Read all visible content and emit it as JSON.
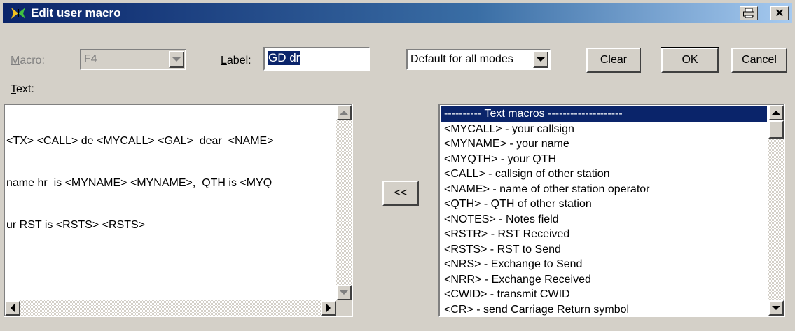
{
  "window": {
    "title": "Edit user macro"
  },
  "macro": {
    "label": "Macro:",
    "value": "F4"
  },
  "label_field": {
    "label": "Label:",
    "value": "GD dr"
  },
  "text_label": "Text:",
  "mode": {
    "value": "Default for all modes"
  },
  "buttons": {
    "clear": "Clear",
    "ok": "OK",
    "cancel": "Cancel",
    "insert": "<<"
  },
  "text_content": [
    "<TX> <CALL> de <MYCALL> <GAL>  dear  <NAME>",
    "name hr  is <MYNAME> <MYNAME>,  QTH is <MYQ",
    "ur RST is <RSTS> <RSTS>"
  ],
  "list": {
    "items": [
      "---------- Text macros --------------------",
      "<MYCALL> - your callsign",
      "<MYNAME> - your name",
      "<MYQTH> - your QTH",
      "<CALL> - callsign of other station",
      "<NAME> - name of other station operator",
      "<QTH> - QTH of other station",
      "<NOTES> - Notes field",
      "<RSTR> - RST Received",
      "<RSTS> - RST to Send",
      "<NRS> - Exchange to Send",
      "<NRR> - Exchange Received",
      "<CWID> - transmit CWID",
      "<CR> - send Carriage Return symbol"
    ],
    "selected_index": 0
  },
  "icons": {
    "app": "butterfly-icon",
    "print": "printer-icon",
    "close": "close-icon"
  },
  "colors": {
    "title_start": "#0a246a",
    "title_end": "#a6caf0",
    "selection": "#0a246a"
  }
}
